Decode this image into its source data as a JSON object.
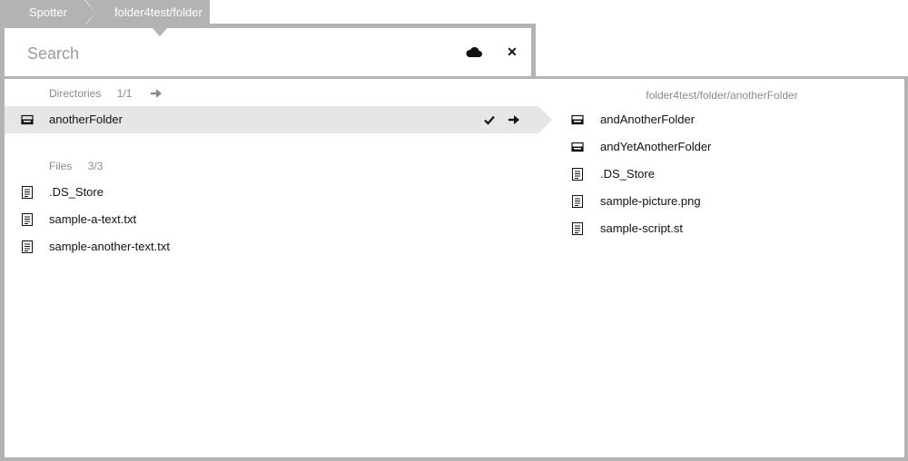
{
  "breadcrumb": {
    "items": [
      {
        "label": "Spotter"
      },
      {
        "label": "folder4test/folder"
      }
    ]
  },
  "search": {
    "placeholder": "Search",
    "value": ""
  },
  "directories": {
    "title": "Directories",
    "count": "1/1",
    "items": [
      {
        "label": "anotherFolder",
        "selected": true
      }
    ]
  },
  "files": {
    "title": "Files",
    "count": "3/3",
    "items": [
      {
        "label": ".DS_Store"
      },
      {
        "label": "sample-a-text.txt"
      },
      {
        "label": "sample-another-text.txt"
      }
    ]
  },
  "preview": {
    "path": "folder4test/folder/anotherFolder",
    "items": [
      {
        "label": "andAnotherFolder",
        "kind": "folder"
      },
      {
        "label": "andYetAnotherFolder",
        "kind": "folder"
      },
      {
        "label": ".DS_Store",
        "kind": "file"
      },
      {
        "label": "sample-picture.png",
        "kind": "file"
      },
      {
        "label": "sample-script.st",
        "kind": "file"
      }
    ]
  },
  "icons": {
    "cloud": "cloud-icon",
    "close": "close-icon",
    "folder": "folder-icon",
    "file": "file-icon",
    "check": "check-icon",
    "arrow": "arrow-right-icon"
  },
  "colors": {
    "frame": "#b3b3b3",
    "selection": "#e6e6e6",
    "muted_text": "#8a8a8a"
  }
}
